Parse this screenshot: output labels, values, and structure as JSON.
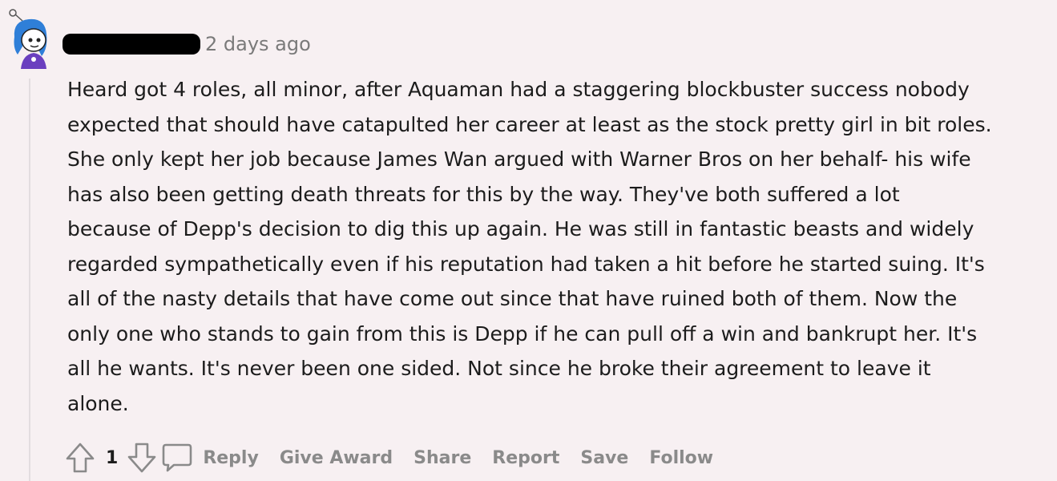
{
  "comment": {
    "timestamp": "2 days ago",
    "body": "Heard got 4 roles, all minor, after Aquaman had a staggering blockbuster success nobody\nexpected that should have catapulted her career at least as the stock pretty girl in bit roles.\nShe only kept her job because James Wan argued with Warner Bros on her behalf- his wife\nhas also been getting death threats for this by the way. They've both suffered a lot\nbecause of Depp's decision to dig this up again. He was still in fantastic beasts and widely\nregarded sympathetically even if his reputation had taken a hit before he started suing. It's\nall of the nasty details that have come out since that have ruined both of them. Now the\nonly one who stands to gain from this is Depp if he can pull off a win and bankrupt her. It's\nall he wants. It's never been one sided. Not since he broke their agreement to leave it\nalone.",
    "vote_count": "1"
  },
  "actions": {
    "reply": "Reply",
    "give_award": "Give Award",
    "share": "Share",
    "report": "Report",
    "save": "Save",
    "follow": "Follow"
  },
  "icons": {
    "upvote": "arrow-up-icon",
    "downvote": "arrow-down-icon",
    "reply": "speech-bubble-icon",
    "avatar": "snoo-avatar"
  },
  "colors": {
    "background": "#f7f0f2",
    "text": "#1c1c1c",
    "muted": "#8a8a8a",
    "avatar_hair": "#2f7fd8",
    "avatar_outfit": "#6a3fbf"
  }
}
